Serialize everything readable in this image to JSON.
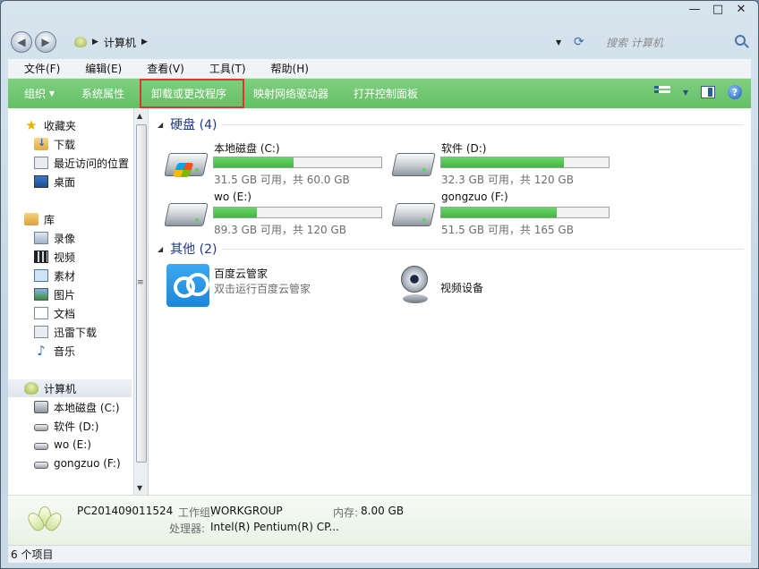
{
  "window": {
    "caption_min": "—",
    "caption_max": "□",
    "caption_close": "✕"
  },
  "address": {
    "path": "计算机",
    "search_placeholder": "搜索 计算机"
  },
  "menu": [
    "文件(F)",
    "编辑(E)",
    "查看(V)",
    "工具(T)",
    "帮助(H)"
  ],
  "commands": {
    "organize": "组织",
    "system_properties": "系统属性",
    "uninstall": "卸载或更改程序",
    "map_drive": "映射网络驱动器",
    "control_panel": "打开控制面板",
    "help": "?"
  },
  "nav": {
    "favorites": "收藏夹",
    "downloads": "下载",
    "recent": "最近访问的位置",
    "desktop": "桌面",
    "libraries": "库",
    "recordings": "录像",
    "videos": "视频",
    "materials": "素材",
    "pictures": "图片",
    "documents": "文档",
    "thunder": "迅雷下载",
    "music": "音乐",
    "computer": "计算机",
    "drive_c": "本地磁盘 (C:)",
    "drive_d": "软件 (D:)",
    "drive_e": "wo (E:)",
    "drive_f": "gongzuo (F:)"
  },
  "groups": {
    "hard_disks": "硬盘 (4)",
    "other": "其他 (2)"
  },
  "drives": [
    {
      "name": "本地磁盘 (C:)",
      "space": "31.5 GB 可用，共 60.0 GB",
      "used_fraction": 0.475
    },
    {
      "name": "软件 (D:)",
      "space": "32.3 GB 可用，共 120 GB",
      "used_fraction": 0.731
    },
    {
      "name": "wo (E:)",
      "space": "89.3 GB 可用，共 120 GB",
      "used_fraction": 0.256
    },
    {
      "name": "gongzuo (F:)",
      "space": "51.5 GB 可用，共 165 GB",
      "used_fraction": 0.688
    }
  ],
  "other_items": {
    "baidu_name": "百度云管家",
    "baidu_sub": "双击运行百度云管家",
    "camera_name": "视频设备"
  },
  "details": {
    "pc_name": "PC201409011524",
    "workgroup_label": "工作组:",
    "workgroup_value": "WORKGROUP",
    "memory_label": "内存:",
    "memory_value": "8.00 GB",
    "cpu_label": "处理器:",
    "cpu_value": "Intel(R) Pentium(R) CP..."
  },
  "status": {
    "item_count": "6 个项目"
  },
  "colors": {
    "command_bar": "#64c064",
    "highlight_border": "#e23232",
    "group_header": "#1e3a8a",
    "space_bar": "#3fb73f"
  }
}
